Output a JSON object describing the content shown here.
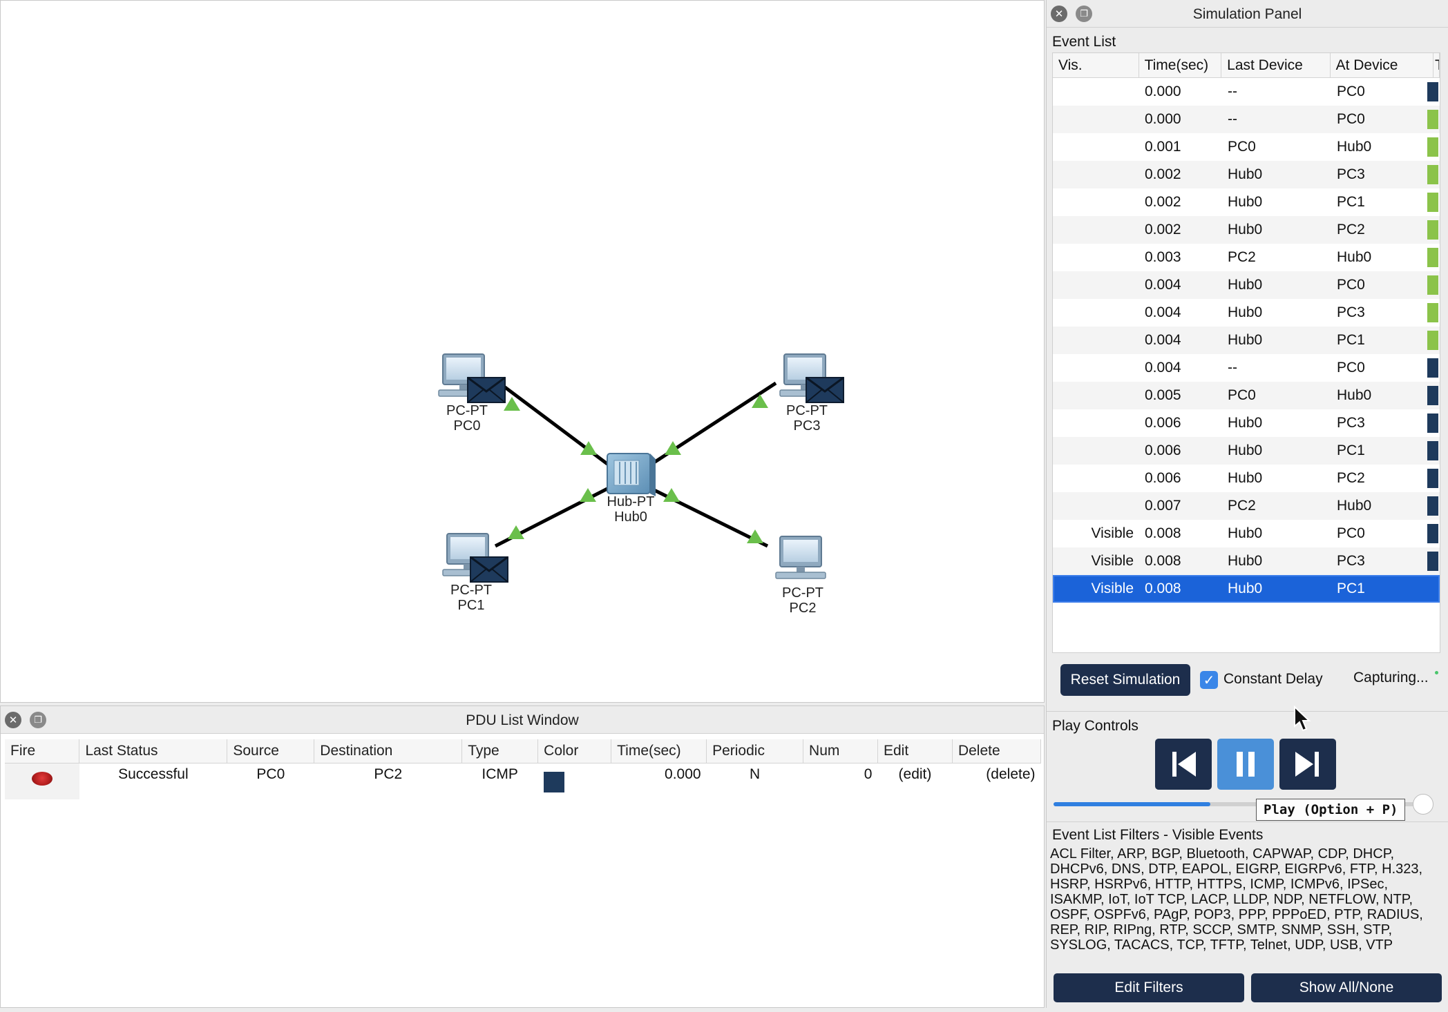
{
  "workspace": {
    "devices": [
      {
        "type_label": "PC-PT",
        "name": "PC0"
      },
      {
        "type_label": "PC-PT",
        "name": "PC3"
      },
      {
        "type_label": "Hub-PT",
        "name": "Hub0"
      },
      {
        "type_label": "PC-PT",
        "name": "PC1"
      },
      {
        "type_label": "PC-PT",
        "name": "PC2"
      }
    ]
  },
  "pdu_window": {
    "title": "PDU List Window",
    "columns": [
      "Fire",
      "Last Status",
      "Source",
      "Destination",
      "Type",
      "Color",
      "Time(sec)",
      "Periodic",
      "Num",
      "Edit",
      "Delete"
    ],
    "rows": [
      {
        "last_status": "Successful",
        "source": "PC0",
        "destination": "PC2",
        "type": "ICMP",
        "color": "#1e3a5c",
        "time": "0.000",
        "periodic": "N",
        "num": "0",
        "edit": "(edit)",
        "delete": "(delete)"
      }
    ]
  },
  "sim_panel": {
    "title": "Simulation Panel",
    "event_list_label": "Event List",
    "columns": [
      "Vis.",
      "Time(sec)",
      "Last Device",
      "At Device",
      "T"
    ],
    "events": [
      {
        "vis": "",
        "time": "0.000",
        "last": "--",
        "at": "PC0",
        "type_color": "#1e3a5c"
      },
      {
        "vis": "",
        "time": "0.000",
        "last": "--",
        "at": "PC0",
        "type_color": "#8bc34a"
      },
      {
        "vis": "",
        "time": "0.001",
        "last": "PC0",
        "at": "Hub0",
        "type_color": "#8bc34a"
      },
      {
        "vis": "",
        "time": "0.002",
        "last": "Hub0",
        "at": "PC3",
        "type_color": "#8bc34a"
      },
      {
        "vis": "",
        "time": "0.002",
        "last": "Hub0",
        "at": "PC1",
        "type_color": "#8bc34a"
      },
      {
        "vis": "",
        "time": "0.002",
        "last": "Hub0",
        "at": "PC2",
        "type_color": "#8bc34a"
      },
      {
        "vis": "",
        "time": "0.003",
        "last": "PC2",
        "at": "Hub0",
        "type_color": "#8bc34a"
      },
      {
        "vis": "",
        "time": "0.004",
        "last": "Hub0",
        "at": "PC0",
        "type_color": "#8bc34a"
      },
      {
        "vis": "",
        "time": "0.004",
        "last": "Hub0",
        "at": "PC3",
        "type_color": "#8bc34a"
      },
      {
        "vis": "",
        "time": "0.004",
        "last": "Hub0",
        "at": "PC1",
        "type_color": "#8bc34a"
      },
      {
        "vis": "",
        "time": "0.004",
        "last": "--",
        "at": "PC0",
        "type_color": "#1e3a5c"
      },
      {
        "vis": "",
        "time": "0.005",
        "last": "PC0",
        "at": "Hub0",
        "type_color": "#1e3a5c"
      },
      {
        "vis": "",
        "time": "0.006",
        "last": "Hub0",
        "at": "PC3",
        "type_color": "#1e3a5c"
      },
      {
        "vis": "",
        "time": "0.006",
        "last": "Hub0",
        "at": "PC1",
        "type_color": "#1e3a5c"
      },
      {
        "vis": "",
        "time": "0.006",
        "last": "Hub0",
        "at": "PC2",
        "type_color": "#1e3a5c"
      },
      {
        "vis": "",
        "time": "0.007",
        "last": "PC2",
        "at": "Hub0",
        "type_color": "#1e3a5c"
      },
      {
        "vis": "Visible",
        "time": "0.008",
        "last": "Hub0",
        "at": "PC0",
        "type_color": "#1e3a5c"
      },
      {
        "vis": "Visible",
        "time": "0.008",
        "last": "Hub0",
        "at": "PC3",
        "type_color": "#1e3a5c"
      },
      {
        "vis": "Visible",
        "time": "0.008",
        "last": "Hub0",
        "at": "PC1",
        "type_color": "#1e3a5c",
        "selected": true
      }
    ],
    "reset_label": "Reset Simulation",
    "constant_delay_label": "Constant Delay",
    "constant_delay_checked": true,
    "capturing_label": "Capturing...",
    "play_controls_label": "Play Controls",
    "play_tooltip": "Play (Option + P)",
    "speed_fraction": 0.42,
    "filters_label": "Event List Filters - Visible Events",
    "filters_text": "ACL Filter, ARP, BGP, Bluetooth, CAPWAP, CDP, DHCP, DHCPv6, DNS, DTP, EAPOL, EIGRP, EIGRPv6, FTP, H.323, HSRP, HSRPv6, HTTP, HTTPS, ICMP, ICMPv6, IPSec, ISAKMP, IoT, IoT TCP, LACP, LLDP, NDP, NETFLOW, NTP, OSPF, OSPFv6, PAgP, POP3, PPP, PPPoED, PTP, RADIUS, REP, RIP, RIPng, RTP, SCCP, SMTP, SNMP, SSH, STP, SYSLOG, TACACS, TCP, TFTP, Telnet, UDP, USB, VTP",
    "edit_filters_label": "Edit Filters",
    "show_all_label": "Show All/None"
  },
  "colors": {
    "accent_dark": "#1d2e4c",
    "selection": "#1b63d9",
    "link_up": "#6abf4b"
  }
}
